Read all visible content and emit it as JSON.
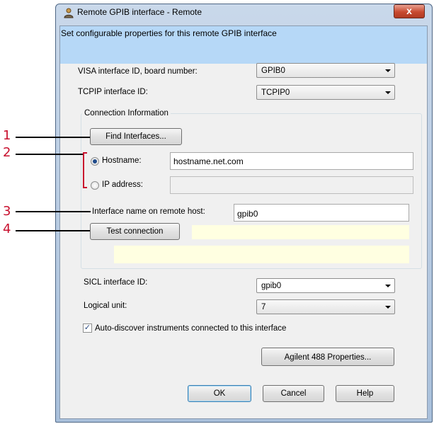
{
  "window": {
    "title": "Remote GPIB interface - Remote",
    "close_label": "x"
  },
  "banner": {
    "text": "Set configurable properties for this remote GPIB interface"
  },
  "visa": {
    "label": "VISA interface ID, board number:",
    "value": "GPIB0"
  },
  "tcpip": {
    "label": "TCPIP interface ID:",
    "value": "TCPIP0"
  },
  "connection": {
    "group_title": "Connection Information",
    "find_button": "Find Interfaces...",
    "hostname_label": "Hostname:",
    "hostname_value": "hostname.net.com",
    "hostname_selected": true,
    "ip_label": "IP address:",
    "ip_value": "",
    "interface_name_label": "Interface name on remote host:",
    "interface_name_value": "gpib0",
    "test_button": "Test connection",
    "status_text": "",
    "status_detail": ""
  },
  "sicl": {
    "label": "SICL interface ID:",
    "value": "gpib0"
  },
  "logical_unit": {
    "label": "Logical unit:",
    "value": "7"
  },
  "auto_discover": {
    "label": "Auto-discover instruments connected to this interface",
    "checked": true
  },
  "buttons": {
    "properties": "Agilent 488 Properties...",
    "ok": "OK",
    "cancel": "Cancel",
    "help": "Help"
  },
  "callouts": [
    "1",
    "2",
    "3",
    "4"
  ],
  "colors": {
    "callout": "#c8102e",
    "banner": "#b6d8f7",
    "status_field": "#ffffe1"
  },
  "icons": {
    "app": "user-network-icon",
    "close": "close-icon",
    "dropdown": "chevron-down-icon",
    "check": "checkmark-icon"
  }
}
